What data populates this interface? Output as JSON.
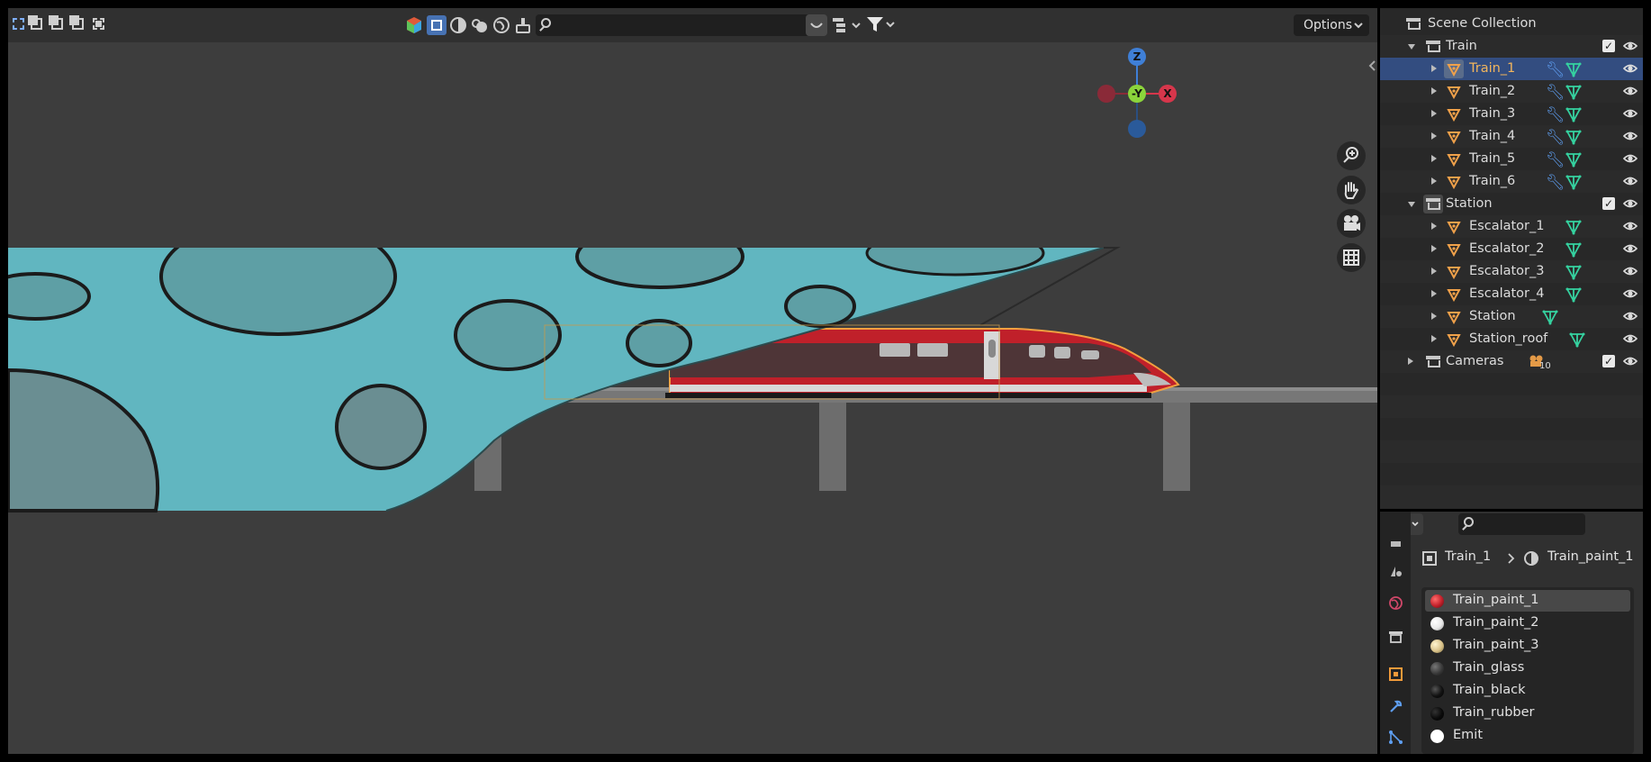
{
  "viewport": {
    "search_placeholder": "",
    "options_label": "Options",
    "gizmo": {
      "z": "Z",
      "y": "-Y",
      "x": "X"
    },
    "icons": [
      "zoom-icon",
      "hand-icon",
      "camera-icon",
      "grid-icon"
    ]
  },
  "outliner": {
    "scene_collection": "Scene Collection",
    "rows": [
      {
        "label": "Train",
        "type": "collection",
        "expanded": true
      },
      {
        "label": "Train_1",
        "type": "object",
        "active": true,
        "modifier": true
      },
      {
        "label": "Train_2",
        "type": "object",
        "modifier": true
      },
      {
        "label": "Train_3",
        "type": "object",
        "modifier": true
      },
      {
        "label": "Train_4",
        "type": "object",
        "modifier": true
      },
      {
        "label": "Train_5",
        "type": "object",
        "modifier": true
      },
      {
        "label": "Train_6",
        "type": "object",
        "modifier": true
      },
      {
        "label": "Station",
        "type": "collection",
        "expanded": true
      },
      {
        "label": "Escalator_1",
        "type": "object"
      },
      {
        "label": "Escalator_2",
        "type": "object"
      },
      {
        "label": "Escalator_3",
        "type": "object"
      },
      {
        "label": "Escalator_4",
        "type": "object"
      },
      {
        "label": "Station",
        "type": "object"
      },
      {
        "label": "Station_roof",
        "type": "object"
      },
      {
        "label": "Cameras",
        "type": "collection",
        "expanded": false,
        "camera_count": "10"
      }
    ]
  },
  "properties": {
    "breadcrumb": {
      "object": "Train_1",
      "material": "Train_paint_1"
    },
    "materials": [
      {
        "name": "Train_paint_1",
        "color": "#c0202a",
        "selected": true
      },
      {
        "name": "Train_paint_2",
        "color": "#e8e8e8"
      },
      {
        "name": "Train_paint_3",
        "color": "#d9c28a"
      },
      {
        "name": "Train_glass",
        "color": "#3a3a3a"
      },
      {
        "name": "Train_black",
        "color": "#111111"
      },
      {
        "name": "Train_rubber",
        "color": "#0a0a0a"
      },
      {
        "name": "Emit",
        "color": "#ffffff"
      }
    ]
  }
}
